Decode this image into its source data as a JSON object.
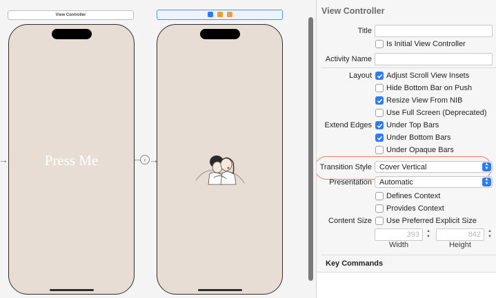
{
  "canvas": {
    "scene1_title": "View Controller",
    "scene1_button_text": "Press Me"
  },
  "inspector": {
    "title": "View Controller",
    "title_label": "Title",
    "title_value": "",
    "initial_vc_label": "Is Initial View Controller",
    "initial_vc_checked": false,
    "activity_name_label": "Activity Name",
    "activity_name_value": "",
    "layout_label": "Layout",
    "layout_options": [
      {
        "label": "Adjust Scroll View Insets",
        "checked": true
      },
      {
        "label": "Hide Bottom Bar on Push",
        "checked": false
      },
      {
        "label": "Resize View From NIB",
        "checked": true
      },
      {
        "label": "Use Full Screen (Deprecated)",
        "checked": false
      }
    ],
    "extend_edges_label": "Extend Edges",
    "extend_edges_options": [
      {
        "label": "Under Top Bars",
        "checked": true
      },
      {
        "label": "Under Bottom Bars",
        "checked": true
      },
      {
        "label": "Under Opaque Bars",
        "checked": false
      }
    ],
    "transition_style_label": "Transition Style",
    "transition_style_value": "Cover Vertical",
    "presentation_label": "Presentation",
    "presentation_value": "Automatic",
    "defines_context_label": "Defines Context",
    "provides_context_label": "Provides Context",
    "content_size_label": "Content Size",
    "use_preferred_label": "Use Preferred Explicit Size",
    "width_value": "393",
    "height_value": "842",
    "width_label": "Width",
    "height_label": "Height",
    "key_commands_label": "Key Commands"
  },
  "colors": {
    "accent": "#2f7bf5",
    "highlight_ring": "#ec7a5f",
    "phone_background": "#e7ddd5"
  }
}
